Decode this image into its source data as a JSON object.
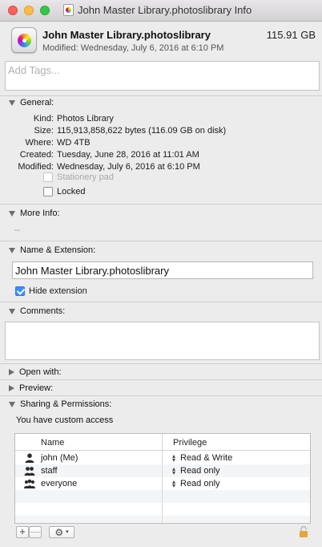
{
  "window": {
    "title": "John Master Library.photoslibrary Info"
  },
  "header": {
    "name": "John Master Library.photoslibrary",
    "size": "115.91 GB",
    "modified": "Modified: Wednesday, July 6, 2016 at 6:10 PM"
  },
  "tags": {
    "placeholder": "Add Tags..."
  },
  "general": {
    "label": "General:",
    "rows": [
      {
        "key": "Kind:",
        "value": "Photos Library"
      },
      {
        "key": "Size:",
        "value": "115,913,858,622 bytes (116.09 GB on disk)"
      },
      {
        "key": "Where:",
        "value": "WD 4TB"
      },
      {
        "key": "Created:",
        "value": "Tuesday, June 28, 2016 at 11:01 AM"
      },
      {
        "key": "Modified:",
        "value": "Wednesday, July 6, 2016 at 6:10 PM"
      }
    ],
    "stationery_label": "Stationery pad",
    "locked_label": "Locked"
  },
  "more_info": {
    "label": "More Info:",
    "value": "--"
  },
  "name_ext": {
    "label": "Name & Extension:",
    "value": "John Master Library.photoslibrary",
    "hide_extension_label": "Hide extension",
    "hide_extension_checked": true
  },
  "comments": {
    "label": "Comments:"
  },
  "open_with": {
    "label": "Open with:"
  },
  "preview": {
    "label": "Preview:"
  },
  "sharing": {
    "label": "Sharing & Permissions:",
    "access_text": "You have custom access",
    "columns": [
      "Name",
      "Privilege"
    ],
    "rows": [
      {
        "name": "john (Me)",
        "privilege": "Read & Write",
        "icon": "single-user-icon"
      },
      {
        "name": "staff",
        "privilege": "Read only",
        "icon": "group-icon"
      },
      {
        "name": "everyone",
        "privilege": "Read only",
        "icon": "everyone-icon"
      }
    ]
  },
  "toolbar": {
    "add": "+",
    "remove": "—",
    "gear": "⚙",
    "chevron": "▾"
  },
  "colors": {
    "accent": "#3b8efc",
    "close": "#fc615d",
    "minimize": "#fdbc40",
    "maximize": "#34c84a",
    "lock": "#e8a33a"
  }
}
